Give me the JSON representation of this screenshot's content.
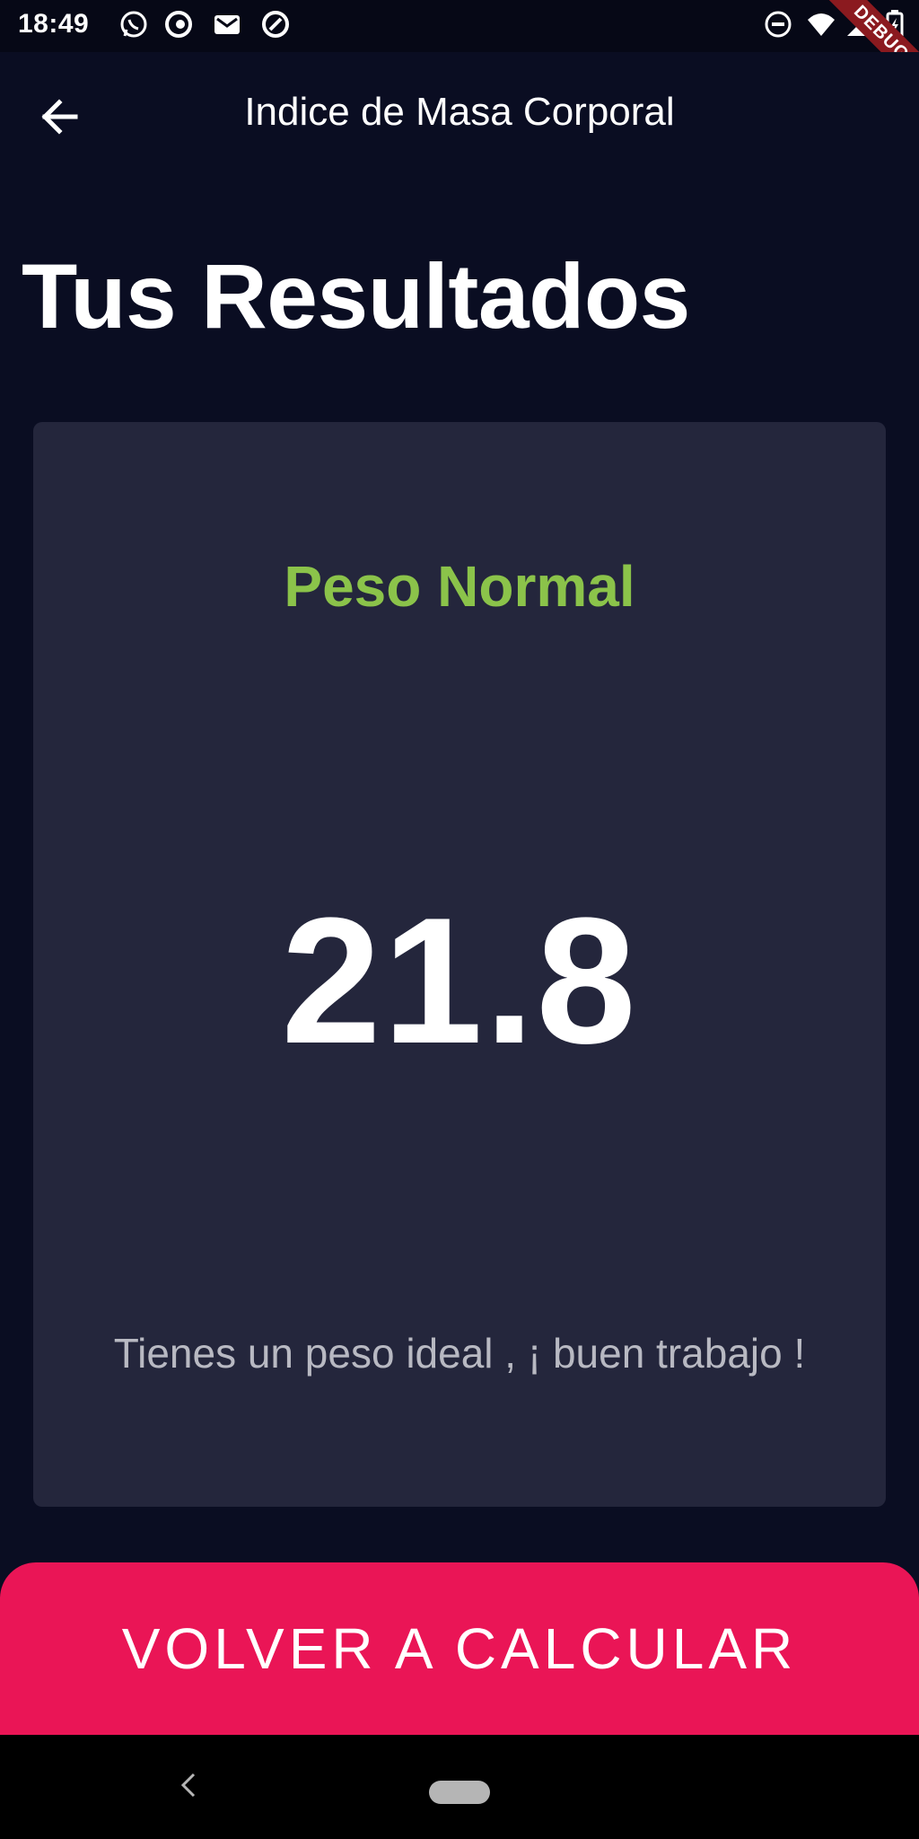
{
  "status_bar": {
    "time": "18:49",
    "left_icons": [
      "whatsapp-icon",
      "opera-icon",
      "gmail-icon",
      "opera-alt-icon"
    ],
    "right_icons": [
      "do-not-disturb-icon",
      "wifi-icon",
      "signal-icon",
      "battery-icon"
    ],
    "debug_label": "DEBUG"
  },
  "app_bar": {
    "title": "Indice de Masa Corporal",
    "back_icon": "arrow-back-icon"
  },
  "page": {
    "title": "Tus Resultados"
  },
  "result": {
    "status": "Peso Normal",
    "status_color": "#8bc34a",
    "value": "21.8",
    "message": "Tienes un peso ideal , ¡ buen trabajo !"
  },
  "actions": {
    "recalculate_label": "VOLVER A CALCULAR",
    "button_color": "#ea1556"
  },
  "nav_bar": {
    "icons": [
      "nav-back-icon",
      "nav-home-icon"
    ]
  }
}
